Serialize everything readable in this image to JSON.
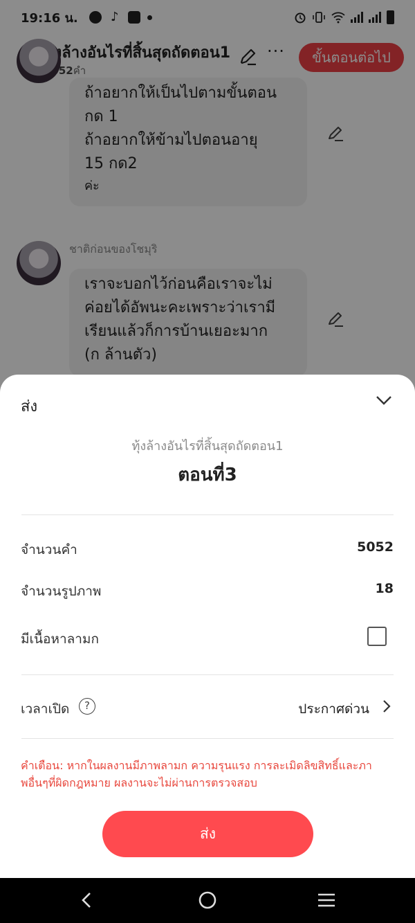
{
  "status_bar": {
    "time": "19:16 น.",
    "left_icons": [
      "facebook-icon",
      "tiktok-icon",
      "mail-icon",
      "dot-icon"
    ],
    "right_icons": [
      "alarm-icon",
      "vibrate-icon",
      "wifi-icon",
      "signal-icon",
      "signal-icon",
      "battery-icon"
    ]
  },
  "header": {
    "title": "ทุ้งล้างอันไรที่สิ้นสุดถัดตอน1",
    "word_count": "5052",
    "word_unit": "คำ",
    "next_button": "ขั้นตอนต่อไป"
  },
  "chat": {
    "bubble1_lines": [
      "ถ้าอยากให้เป็นไปตามขั้นตอน",
      "กด 1",
      "ถ้าอยากให้ข้ามไปตอนอายุ",
      "15 กด2"
    ],
    "bubble1_tail": "ค่ะ",
    "sender2": "ชาติก่อนของโชมุริ",
    "bubble2_lines": [
      "เราจะบอกไว้ก่อนคือเราจะไม่",
      "ค่อยได้อัพนะคะเพราะว่าเรามี",
      "เรียนแล้วก็การบ้านเยอะมาก",
      "(ก ล้านตัว)"
    ]
  },
  "sheet": {
    "title": "ส่ง",
    "work_title": "ทุ้งล้างอันไรที่สิ้นสุดถัดตอน1",
    "episode": "ตอนที่3",
    "word_count_label": "จำนวนคำ",
    "word_count_value": "5052",
    "image_count_label": "จำนวนรูปภาพ",
    "image_count_value": "18",
    "adult_label": "มีเนื้อหาลามก",
    "adult_checked": false,
    "publish_label": "เวลาเปิด",
    "publish_help": "?",
    "publish_value": "ประกาศด่วน",
    "warning": "คำเตือน: หากในผลงานมีภาพลามก ความรุนแรง การละเมิดลิขสิทธิ์และภาพอื่นๆที่ผิดกฎหมาย ผลงานจะไม่ผ่านการตรวจสอบ",
    "submit_button": "ส่ง"
  },
  "colors": {
    "accent": "#ef4145",
    "submit": "#ff4a4f",
    "warning": "#e8473d"
  },
  "nav": [
    "back-nav-icon",
    "home-nav-icon",
    "recents-nav-icon"
  ]
}
